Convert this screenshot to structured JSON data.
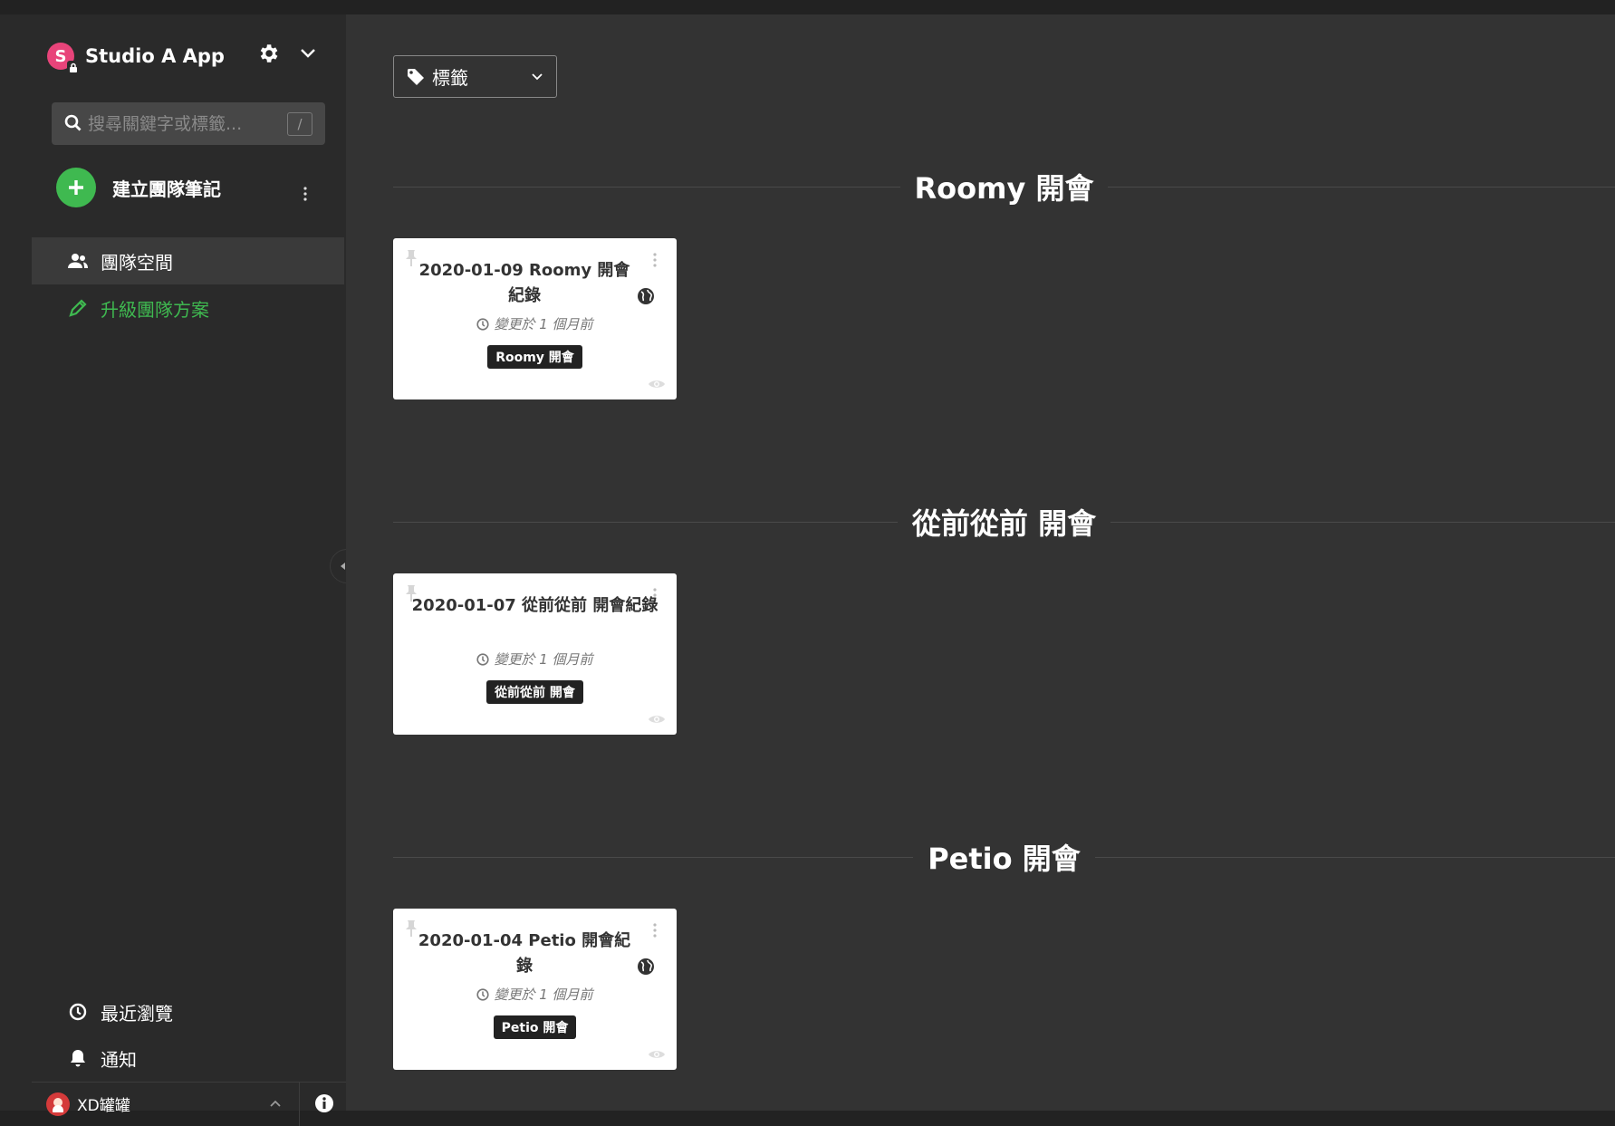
{
  "app": {
    "brand_initial": "S",
    "name": "Studio A App"
  },
  "search": {
    "placeholder": "搜尋關鍵字或標籤...",
    "shortcut": "/"
  },
  "create": {
    "label": "建立團隊筆記"
  },
  "nav": {
    "team_space": "團隊空間",
    "upgrade": "升級團隊方案",
    "recent": "最近瀏覽",
    "notifications": "通知"
  },
  "user": {
    "name": "XD罐罐"
  },
  "filter": {
    "label": "標籤"
  },
  "groups": [
    {
      "title": "Roomy 開會",
      "note": {
        "title": "2020-01-09 Roomy 開會紀錄",
        "modified": "變更於 1 個月前",
        "tag": "Roomy 開會",
        "public": true
      }
    },
    {
      "title": "從前從前 開會",
      "note": {
        "title": "2020-01-07 從前從前 開會紀錄",
        "modified": "變更於 1 個月前",
        "tag": "從前從前 開會",
        "public": false
      }
    },
    {
      "title": "Petio 開會",
      "note": {
        "title": "2020-01-04 Petio 開會紀錄",
        "modified": "變更於 1 個月前",
        "tag": "Petio 開會",
        "public": true
      }
    }
  ],
  "colors": {
    "accent_green": "#3fb950",
    "brand_pink": "#e8447a",
    "sidebar_bg": "#2a2a2a",
    "main_bg": "#333333"
  },
  "icons": {
    "gear": "gear-icon",
    "search": "search-icon",
    "plus": "plus-icon",
    "users": "users-icon",
    "pencil": "pencil-icon",
    "clock": "clock-icon",
    "bell": "bell-icon",
    "info": "info-icon",
    "tag": "tag-icon",
    "pin": "pin-icon",
    "globe": "globe-icon",
    "eye": "eye-icon"
  }
}
